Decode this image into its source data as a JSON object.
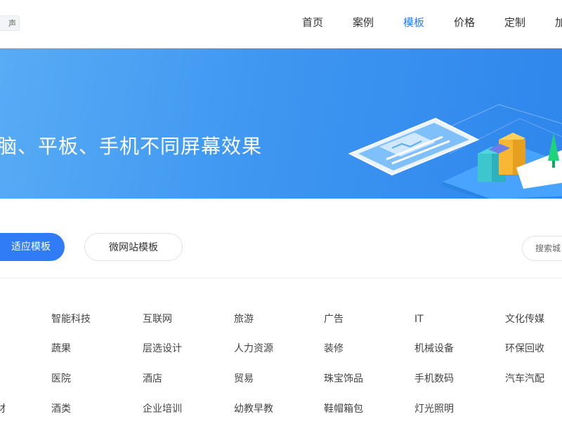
{
  "header": {
    "logo_text": "声",
    "nav": [
      "首页",
      "案例",
      "模板",
      "价格",
      "定制",
      "加"
    ],
    "active_nav": "模板"
  },
  "banner": {
    "text": "脑、平板、手机不同屏幕效果"
  },
  "filter": {
    "primary_tab": "适应模板",
    "secondary_tab": "微网站模板",
    "search_placeholder": "搜索城"
  },
  "categories": [
    [
      "",
      "智能科技",
      "互联网",
      "旅游",
      "广告",
      "IT",
      "文化传媒"
    ],
    [
      "",
      "蔬果",
      "层选设计",
      "人力资源",
      "装修",
      "机械设备",
      "环保回收"
    ],
    [
      "",
      "医院",
      "酒店",
      "贸易",
      "珠宝饰品",
      "手机数码",
      "汽车汽配"
    ],
    [
      "材",
      "酒类",
      "企业培训",
      "幼教早教",
      "鞋帽箱包",
      "灯光照明",
      ""
    ]
  ],
  "colors": {
    "accent": "#2f7cf6",
    "banner_start": "#58acf5",
    "banner_end": "#2f86ec"
  }
}
